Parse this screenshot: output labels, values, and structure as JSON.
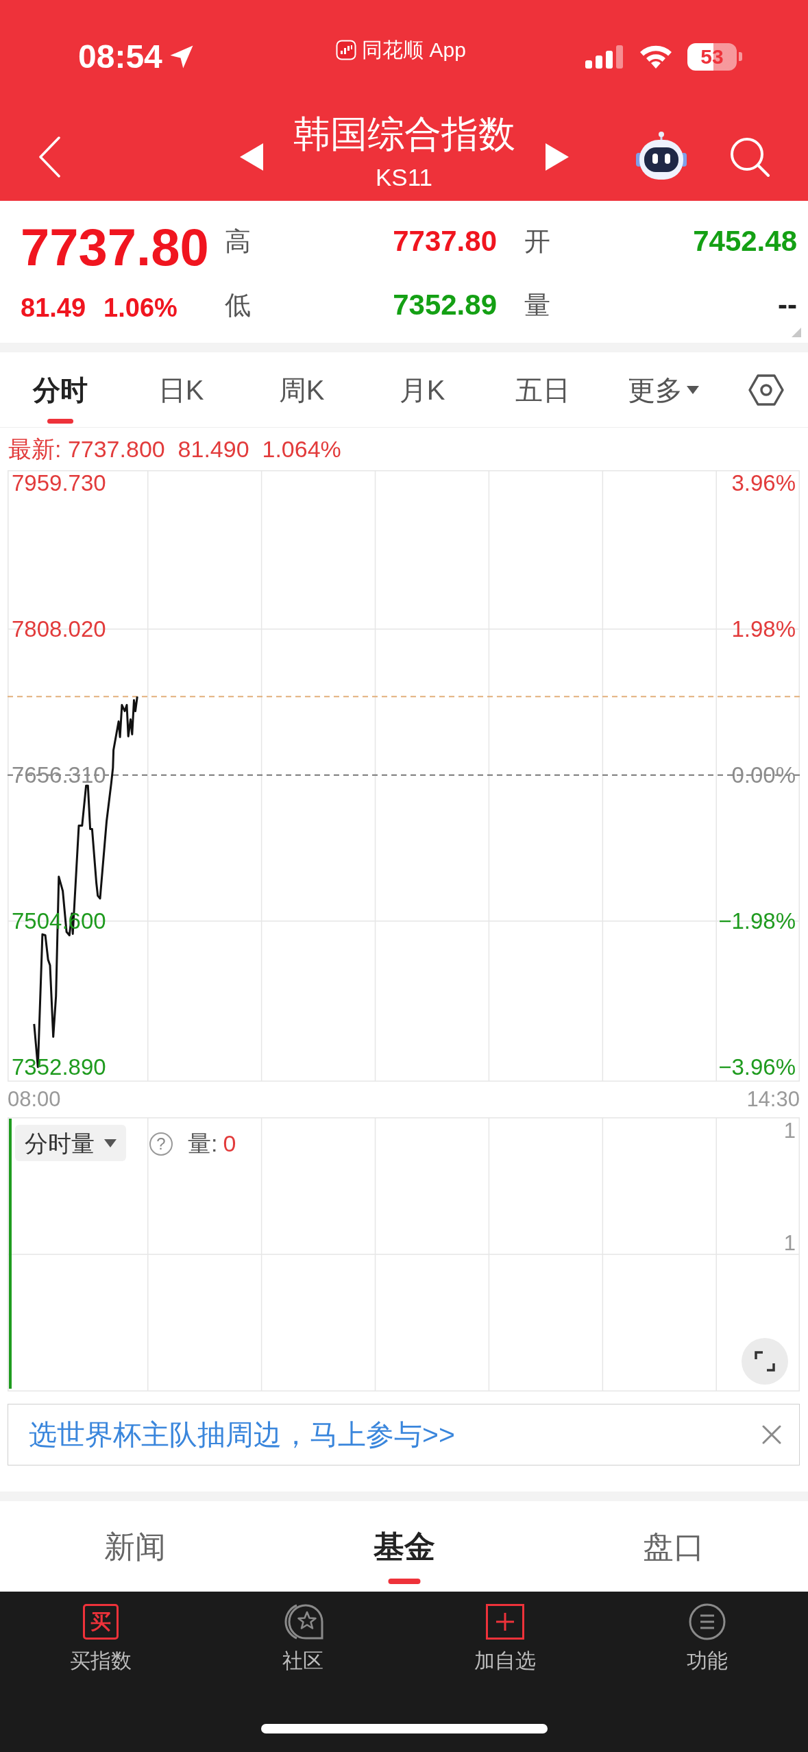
{
  "status_bar": {
    "time": "08:54",
    "back_app": "同花顺 App",
    "battery": "53"
  },
  "header": {
    "title": "韩国综合指数",
    "code": "KS11"
  },
  "quote": {
    "price": "7737.80",
    "change": "81.49",
    "change_pct": "1.06%",
    "rising": true,
    "stats": [
      {
        "label": "高",
        "value": "7737.80",
        "color": "#f0151f"
      },
      {
        "label": "开",
        "value": "7452.48",
        "color": "#14a014"
      },
      {
        "label": "低",
        "value": "7352.89",
        "color": "#14a014"
      },
      {
        "label": "量",
        "value": "--",
        "color": "#222222"
      }
    ]
  },
  "period_tabs": [
    {
      "label": "分时",
      "selected": true,
      "dropdown": false
    },
    {
      "label": "日K",
      "selected": false,
      "dropdown": false
    },
    {
      "label": "周K",
      "selected": false,
      "dropdown": false
    },
    {
      "label": "月K",
      "selected": false,
      "dropdown": false
    },
    {
      "label": "五日",
      "selected": false,
      "dropdown": false
    },
    {
      "label": "更多",
      "selected": false,
      "dropdown": true
    }
  ],
  "latest": "最新: 7737.800  81.490  1.064%",
  "chart": {
    "chart_data": {
      "type": "line",
      "x": [
        8,
        8.033,
        8.073,
        8.098,
        8.123,
        8.14,
        8.168,
        8.192,
        8.217,
        8.252,
        8.285,
        8.31,
        8.332,
        8.34,
        8.393,
        8.422,
        8.457,
        8.473,
        8.493,
        8.51,
        8.547,
        8.56,
        8.58,
        8.637,
        8.678,
        8.693,
        8.698,
        8.743,
        8.755,
        8.772,
        8.797,
        8.815,
        8.828,
        8.848,
        8.862,
        8.878,
        8.89,
        8.907
      ],
      "series": [
        {
          "color": "#111111",
          "values": [
            7397.7,
            7352.9,
            7490.8,
            7489.8,
            7464.3,
            7458.6,
            7384.3,
            7426.7,
            7550.6,
            7535.8,
            7493.3,
            7489.8,
            7512.4,
            7491.2,
            7603.7,
            7603.7,
            7645.2,
            7645.2,
            7600.2,
            7600.2,
            7544.3,
            7530.8,
            7528.0,
            7608.0,
            7647.6,
            7663.9,
            7682.3,
            7712.1,
            7695.8,
            7729.1,
            7722.7,
            7729.1,
            7696.5,
            7714.2,
            7698.6,
            7734.0,
            7722.7,
            7737.8
          ]
        }
      ],
      "xlim": [
        7.766,
        14.734
      ],
      "ylim": [
        7339,
        7972.5
      ],
      "xticks": [
        {
          "value": 8,
          "label": "08:00"
        },
        {
          "value": 14.5,
          "label": "14:30"
        }
      ],
      "yticks": [
        {
          "value": 7959.73,
          "label": "7959.730"
        },
        {
          "value": 7808.02,
          "label": "7808.020"
        },
        {
          "value": 7656.31,
          "label": "7656.310"
        },
        {
          "value": 7504.6,
          "label": "7504.600"
        },
        {
          "value": 7352.89,
          "label": "7352.890"
        }
      ],
      "ref_lines": [
        {
          "axis": "y",
          "value": 7656.31,
          "color": "#777777"
        },
        {
          "axis": "y",
          "value": 7737.8,
          "color": "#e2b07c"
        }
      ]
    },
    "right_ticks": [
      "3.96%",
      "1.98%",
      "0.00%",
      "−1.98%",
      "−3.96%"
    ]
  },
  "volume": {
    "selector": "分时量",
    "help": "?",
    "label": "量:",
    "value": "0",
    "axis_labels": [
      "1",
      "1"
    ]
  },
  "banner": {
    "text": "选世界杯主队抽周边，马上参与>>"
  },
  "bottom_tabs": [
    {
      "label": "新闻",
      "selected": false
    },
    {
      "label": "基金",
      "selected": true
    },
    {
      "label": "盘口",
      "selected": false
    }
  ],
  "nav": [
    {
      "kind": "buy",
      "label": "买指数",
      "icon_text": "买"
    },
    {
      "kind": "community",
      "label": "社区"
    },
    {
      "kind": "add",
      "label": "加自选"
    },
    {
      "kind": "menu",
      "label": "功能"
    }
  ]
}
